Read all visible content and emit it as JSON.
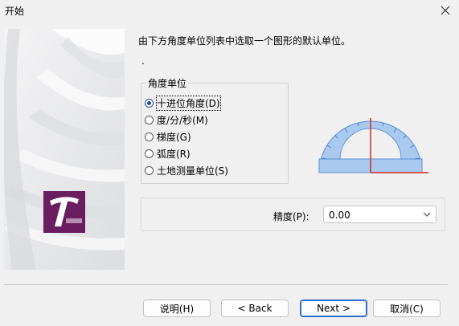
{
  "window": {
    "title": "开始"
  },
  "instruction": "由下方角度单位列表中选取一个图形的默认单位。",
  "dot": ".",
  "angle_units": {
    "group_label": "角度单位",
    "options": [
      {
        "label": "十进位角度(D)",
        "selected": true
      },
      {
        "label": "度/分/秒(M)",
        "selected": false
      },
      {
        "label": "梯度(G)",
        "selected": false
      },
      {
        "label": "弧度(R)",
        "selected": false
      },
      {
        "label": "土地测量单位(S)",
        "selected": false
      }
    ]
  },
  "precision": {
    "label": "精度(P):",
    "value": "0.00"
  },
  "buttons": {
    "help": "说明(H)",
    "back": "< Back",
    "next": "Next >",
    "cancel": "取消(C)"
  },
  "colors": {
    "protractor_fill": "#a9c9ef",
    "protractor_edge": "#5a8fd6",
    "indicator_line": "#d12a1f",
    "logo_bg": "#6a1e60"
  }
}
